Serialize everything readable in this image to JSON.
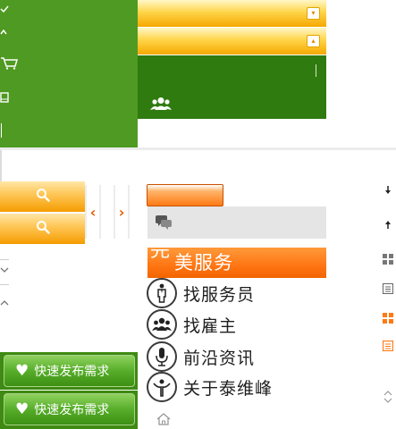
{
  "top_panel": {
    "icons": [
      "check-icon",
      "caret-up-icon",
      "cart-icon",
      "book-icon"
    ]
  },
  "dropdown_bars": [
    {
      "toggle": "▾",
      "icon": "chevron-down-icon"
    },
    {
      "toggle": "▴",
      "icon": "chevron-up-icon"
    }
  ],
  "green_box": {
    "icon": "users-icon"
  },
  "search": {
    "icon": "search-icon"
  },
  "carousel": {
    "prev": "‹",
    "next": "›"
  },
  "service": {
    "title_first": "完",
    "title_rest": "美服务"
  },
  "menu": [
    {
      "label": "找服务员",
      "icon": "waiter-icon"
    },
    {
      "label": "找雇主",
      "icon": "group-icon"
    },
    {
      "label": "前沿资讯",
      "icon": "microphone-icon"
    },
    {
      "label": "关于泰维峰",
      "icon": "logo-icon"
    }
  ],
  "actions": [
    {
      "label": "快速发布需求",
      "icon": "heart-icon"
    },
    {
      "label": "快速发布需求",
      "icon": "heart-icon"
    }
  ],
  "colors": {
    "green": "#4f9a22",
    "dark_green": "#2f7b0f",
    "orange": "#ff7513",
    "gold": "#ffd54a"
  }
}
